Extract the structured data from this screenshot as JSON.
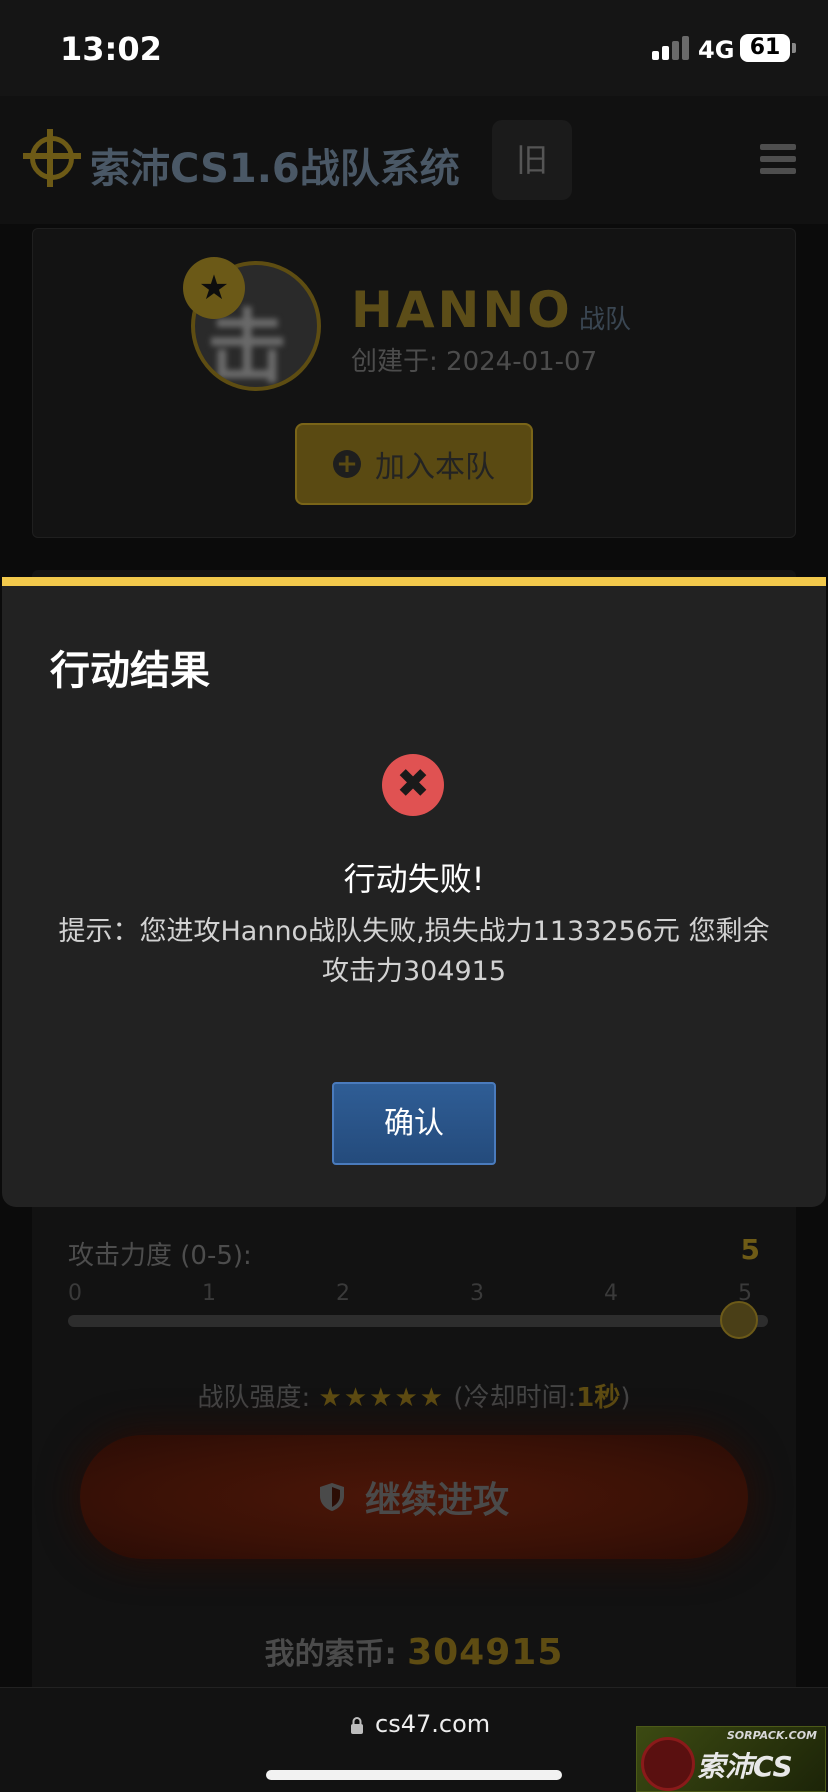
{
  "status_bar": {
    "time": "13:02",
    "network": "4G",
    "battery": "61"
  },
  "header": {
    "title": "索沛CS1.6战队系统",
    "old_button": "旧"
  },
  "team": {
    "avatar_glyph": "击",
    "name": "HANNO",
    "suffix": "战队",
    "created": "创建于: 2024-01-07",
    "join_button": "加入本队"
  },
  "modal": {
    "title": "行动结果",
    "heading": "行动失败!",
    "message": "提示：您进攻Hanno战队失败,损失战力1133256元 您剩余攻击力304915",
    "confirm": "确认",
    "accent_color": "#f2c94c",
    "error_color": "#e05252"
  },
  "attack": {
    "power_label": "攻击力度 (0-5):",
    "power_value": "5",
    "ticks": [
      "0",
      "1",
      "2",
      "3",
      "4",
      "5"
    ],
    "slider_level": 5,
    "strength_label": "战队强度:",
    "strength_stars": "★★★★★",
    "cooldown_open": "(冷却时间:",
    "cooldown_value": "1秒",
    "cooldown_close": ")",
    "attack_button": "继续进攻",
    "coins_label": "我的索币:",
    "coins_value": "304915"
  },
  "browser": {
    "url": "cs47.com",
    "corner_logo_top": "SORPACK.COM",
    "corner_logo_main": "索沛CS"
  }
}
